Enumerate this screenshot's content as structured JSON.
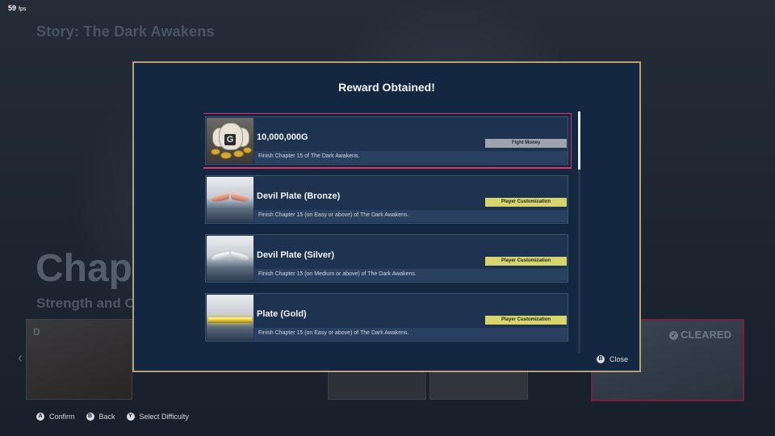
{
  "fps": {
    "value": "59",
    "unit": "fps"
  },
  "background": {
    "title": "Story: The Dark Awakens",
    "chapter_big": "Chapte",
    "chapter_sub": "Strength and Co",
    "cleared_label": "CLEARED",
    "card_letter": "D"
  },
  "bottom_hints": [
    {
      "button": "A",
      "label": "Confirm"
    },
    {
      "button": "B",
      "label": "Back"
    },
    {
      "button": "Y",
      "label": "Select Difficulty"
    }
  ],
  "modal": {
    "title": "Reward Obtained!",
    "close_button": "B",
    "close_label": "Close",
    "items": [
      {
        "name": "10,000,000G",
        "desc": "Finish Chapter 15 of The Dark Awakens.",
        "tag": "Fight Money",
        "icon": "money-bags-icon"
      },
      {
        "name": "Devil Plate (Bronze)",
        "desc": "Finish Chapter 15 (on Easy or above) of The Dark Awakens.",
        "tag": "Player Customization",
        "icon": "devil-wings-bronze-icon"
      },
      {
        "name": "Devil Plate (Silver)",
        "desc": "Finish Chapter 15 (on Medium or above) of The Dark Awakens.",
        "tag": "Player Customization",
        "icon": "devil-wings-silver-icon"
      },
      {
        "name": "Plate (Gold)",
        "desc": "Finish Chapter 15 (on Easy or above) of The Dark Awakens.",
        "tag": "Player Customization",
        "icon": "gold-plate-icon"
      }
    ]
  },
  "colors": {
    "modal_bg": "#142741",
    "modal_border": "#b89f78",
    "selection": "#e0346c",
    "tag_money": "#9fa5ad",
    "tag_custom": "#d6d46a"
  }
}
